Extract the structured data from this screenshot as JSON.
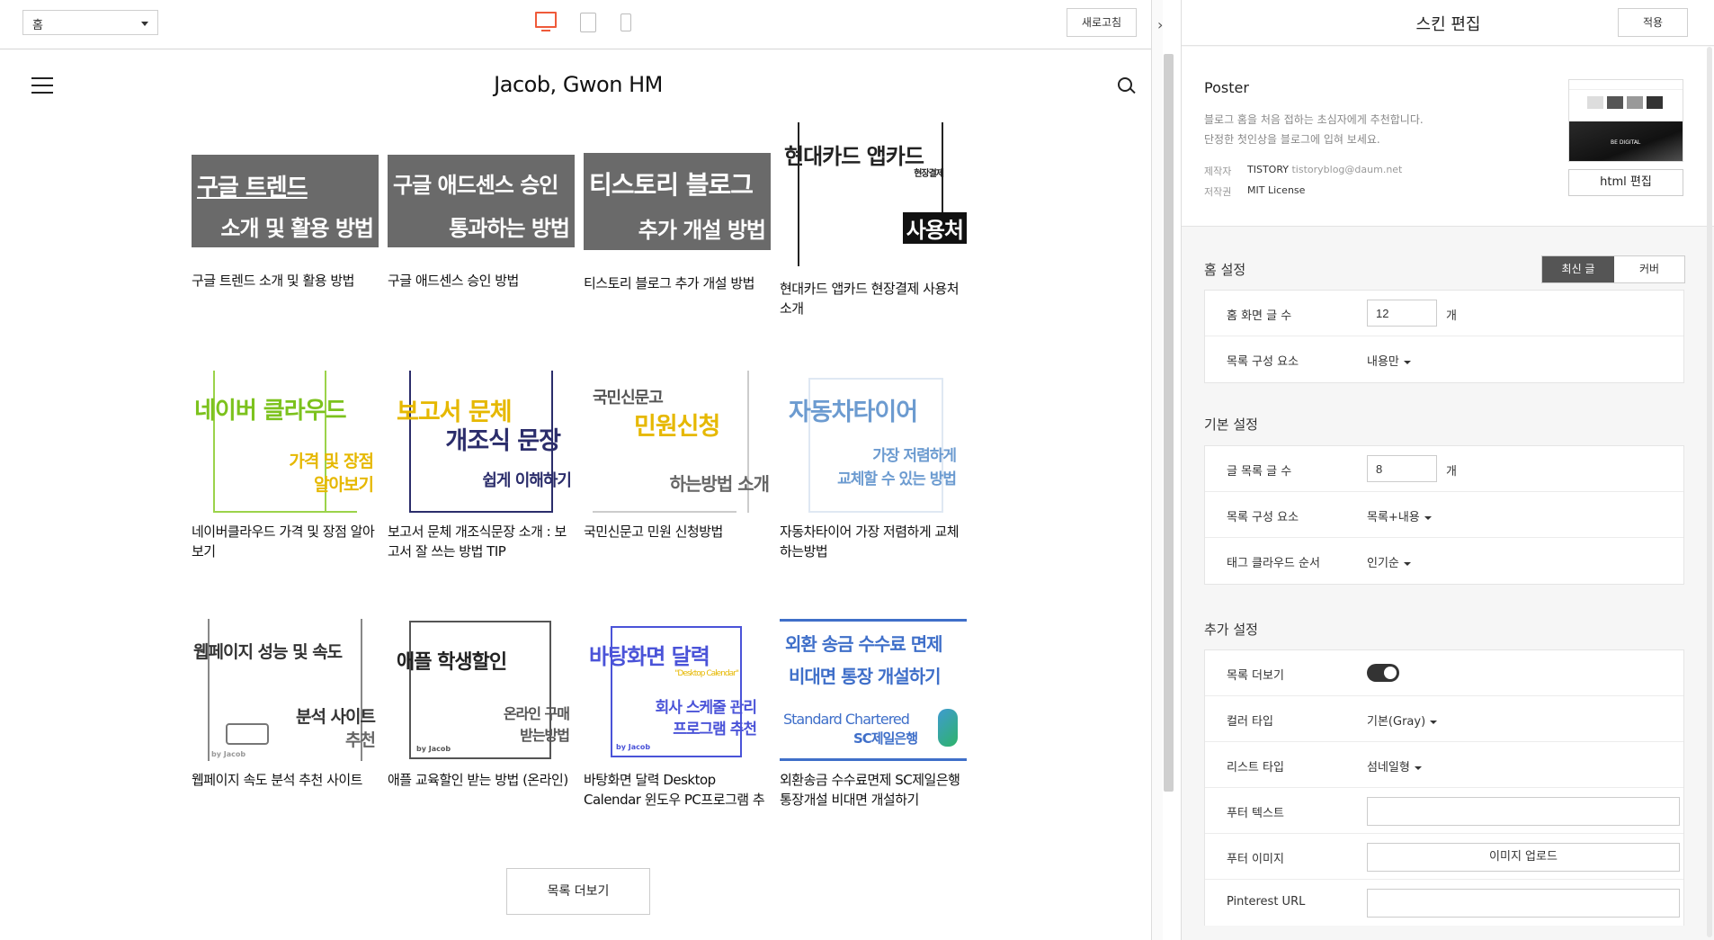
{
  "toolbar": {
    "page_select": "홈",
    "devices": [
      "desktop-icon",
      "tablet-icon",
      "mobile-icon"
    ],
    "refresh_label": "새로고침",
    "collapse_glyph": "›"
  },
  "blog": {
    "title": "Jacob, Gwon HM",
    "more_label": "목록 더보기",
    "posts": [
      {
        "title": "구글 트렌드 소개 및 활용 방법",
        "thumb": [
          "구글 트렌드",
          "소개 및 활용 방법"
        ]
      },
      {
        "title": "구글 애드센스 승인 방법",
        "thumb": [
          "구글 애드센스 승인",
          "통과하는 방법"
        ]
      },
      {
        "title": "티스토리 블로그 추가 개설 방법",
        "thumb": [
          "티스토리 블로그",
          "추가 개설 방법"
        ]
      },
      {
        "title": "현대카드 앱카드 현장결제 사용처 소개",
        "thumb": [
          "현대카드 앱카드",
          "현장결제",
          "사용처"
        ]
      },
      {
        "title": "네이버클라우드 가격 및 장점 알아보기",
        "thumb": [
          "네이버 클라우드",
          "가격 및 장점",
          "알아보기"
        ]
      },
      {
        "title": "보고서 문체 개조식문장 소개 : 보고서 잘 쓰는 방법 TIP",
        "thumb": [
          "보고서 문체",
          "개조식 문장",
          "쉽게 이해하기"
        ]
      },
      {
        "title": "국민신문고 민원 신청방법",
        "thumb": [
          "국민신문고",
          "민원신청",
          "하는방법 소개"
        ]
      },
      {
        "title": "자동차타이어 가장 저렴하게 교체하는방법",
        "thumb": [
          "자동차타이어",
          "가장 저렴하게",
          "교체할 수 있는 방법"
        ]
      },
      {
        "title": "웹페이지 속도 분석 추천 사이트",
        "thumb": [
          "웹페이지 성능 및 속도",
          "분석 사이트",
          "추천"
        ]
      },
      {
        "title": "애플 교육할인 받는 방법 (온라인)",
        "thumb": [
          "애플 학생할인",
          "온라인 구매",
          "받는방법"
        ]
      },
      {
        "title": "바탕화면 달력 Desktop Calendar 윈도우 PC프로그램 추천",
        "thumb": [
          "바탕화면 달력",
          "\"Desktop Calendar\"",
          "회사 스케줄 관리",
          "프로그램 추천"
        ]
      },
      {
        "title": "외환송금 수수료면제 SC제일은행 통장개설 비대면 개설하기",
        "thumb": [
          "외환 송금 수수료 면제",
          "비대면 통장 개설하기",
          "Standard Chartered",
          "SC제일은행"
        ]
      }
    ],
    "thumb_credit": "by Jacob"
  },
  "panel": {
    "title": "스킨 편집",
    "apply_label": "적용",
    "skin": {
      "name": "Poster",
      "desc1": "블로그 홈을 처음 접하는 초심자에게 추천합니다.",
      "desc2": "단정한 첫인상을 블로그에 입혀 보세요.",
      "author_label": "제작자",
      "author_name": "TISTORY",
      "author_email": "tistoryblog@daum.net",
      "license_label": "저작권",
      "license": "MIT License",
      "html_edit_label": "html 편집",
      "thumb_text": "BE DIGITAL"
    },
    "home": {
      "title": "홈 설정",
      "seg_latest": "최신 글",
      "seg_cover": "커버",
      "post_count_label": "홈 화면 글 수",
      "post_count": "12",
      "unit": "개",
      "components_label": "목록 구성 요소",
      "components_value": "내용만"
    },
    "basic": {
      "title": "기본 설정",
      "list_count_label": "글 목록 글 수",
      "list_count": "8",
      "unit": "개",
      "components_label": "목록 구성 요소",
      "components_value": "목록+내용",
      "tag_order_label": "태그 클라우드 순서",
      "tag_order_value": "인기순"
    },
    "extra": {
      "title": "추가 설정",
      "more_label": "목록 더보기",
      "more_on": true,
      "color_label": "컬러 타입",
      "color_value": "기본(Gray)",
      "list_type_label": "리스트 타입",
      "list_type_value": "섬네일형",
      "footer_text_label": "푸터 텍스트",
      "footer_image_label": "푸터 이미지",
      "upload_label": "이미지 업로드",
      "pinterest_label": "Pinterest URL"
    }
  },
  "colors": {
    "accent": "#ef5a3a",
    "thumb_gray": "#6a6a6a",
    "naver_green": "#7cc21d",
    "yellow": "#e6b800",
    "navy": "#2b2d6b",
    "blue": "#3f6fc9"
  }
}
